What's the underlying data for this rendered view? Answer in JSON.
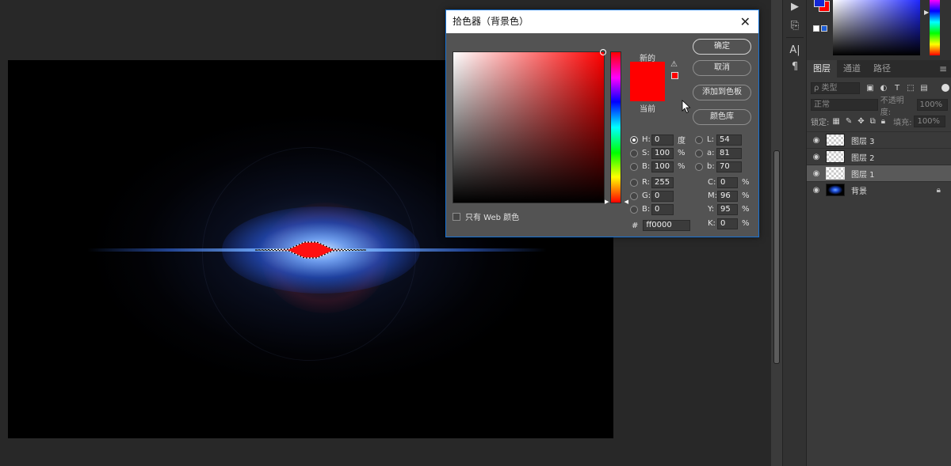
{
  "dialog": {
    "title": "拾色器（背景色）",
    "new_label": "新的",
    "current_label": "当前",
    "new_color": "#ff0000",
    "current_color": "#ff0000",
    "buttons": {
      "ok": "确定",
      "cancel": "取消",
      "add_to_swatches": "添加到色板",
      "color_libraries": "颜色库"
    },
    "fields": {
      "H": {
        "label": "H:",
        "value": "0",
        "unit": "度"
      },
      "S": {
        "label": "S:",
        "value": "100",
        "unit": "%"
      },
      "B": {
        "label": "B:",
        "value": "100",
        "unit": "%"
      },
      "R": {
        "label": "R:",
        "value": "255"
      },
      "G": {
        "label": "G:",
        "value": "0"
      },
      "Bb": {
        "label": "B:",
        "value": "0"
      },
      "L": {
        "label": "L:",
        "value": "54"
      },
      "a": {
        "label": "a:",
        "value": "81"
      },
      "b": {
        "label": "b:",
        "value": "70"
      },
      "C": {
        "label": "C:",
        "value": "0",
        "unit": "%"
      },
      "M": {
        "label": "M:",
        "value": "96",
        "unit": "%"
      },
      "Y": {
        "label": "Y:",
        "value": "95",
        "unit": "%"
      },
      "K": {
        "label": "K:",
        "value": "0",
        "unit": "%"
      }
    },
    "web_only_label": "只有 Web 颜色",
    "hex_label": "#",
    "hex_value": "ff0000"
  },
  "layers_panel": {
    "tabs": [
      "图层",
      "通道",
      "路径"
    ],
    "filter_placeholder": "ρ 类型",
    "blend_mode": "正常",
    "opacity_label": "不透明度:",
    "opacity_value": "100%",
    "lock_label": "锁定:",
    "fill_label": "填充:",
    "fill_value": "100%",
    "layers": [
      {
        "name": "图层 3"
      },
      {
        "name": "图层 2"
      },
      {
        "name": "图层 1"
      },
      {
        "name": "背景"
      }
    ]
  },
  "colors": {
    "foreground": "#1428d6",
    "background": "#ff0000",
    "accent": "#1672d6"
  }
}
